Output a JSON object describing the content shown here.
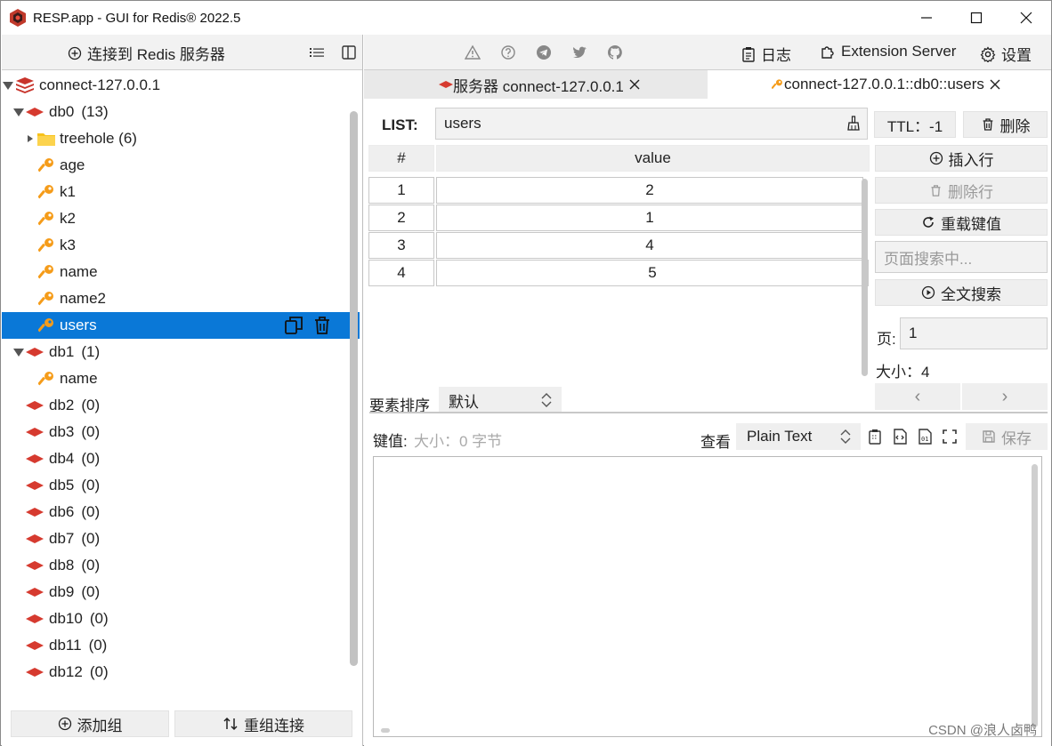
{
  "window": {
    "title": "RESP.app - GUI for Redis® 2022.5"
  },
  "left_toolbar": {
    "connect_label": "连接到 Redis 服务器"
  },
  "tree": {
    "connection": "connect-127.0.0.1",
    "databases": [
      {
        "name": "db0",
        "count": "(13)",
        "expanded": true
      },
      {
        "name": "db1",
        "count": "(1)",
        "expanded": true
      },
      {
        "name": "db2",
        "count": "(0)"
      },
      {
        "name": "db3",
        "count": "(0)"
      },
      {
        "name": "db4",
        "count": "(0)"
      },
      {
        "name": "db5",
        "count": "(0)"
      },
      {
        "name": "db6",
        "count": "(0)"
      },
      {
        "name": "db7",
        "count": "(0)"
      },
      {
        "name": "db8",
        "count": "(0)"
      },
      {
        "name": "db9",
        "count": "(0)"
      },
      {
        "name": "db10",
        "count": "(0)"
      },
      {
        "name": "db11",
        "count": "(0)"
      },
      {
        "name": "db12",
        "count": "(0)"
      }
    ],
    "db0_folder": "treehole (6)",
    "db0_keys": [
      "age",
      "k1",
      "k2",
      "k3",
      "name",
      "name2",
      "users"
    ],
    "db1_keys": [
      "name"
    ],
    "selected_key": "users"
  },
  "left_bottom": {
    "add_group": "添加组",
    "reorder": "重组连接"
  },
  "top_toolbar": {
    "log": "日志",
    "extension": "Extension Server",
    "settings": "设置"
  },
  "tabs": [
    {
      "label": "服务器 connect-127.0.0.1",
      "active": false
    },
    {
      "label": "connect-127.0.0.1::db0::users",
      "active": true
    }
  ],
  "key_view": {
    "type_label": "LIST:",
    "key_name": "users",
    "ttl": "TTL：-1",
    "delete": "删除",
    "columns": [
      "#",
      "value"
    ],
    "rows": [
      {
        "index": "1",
        "value": "2"
      },
      {
        "index": "2",
        "value": "1"
      },
      {
        "index": "3",
        "value": "4"
      },
      {
        "index": "4",
        "value": "5"
      }
    ],
    "insert_row": "插入行",
    "delete_row": "删除行",
    "reload": "重载键值",
    "search_placeholder": "页面搜索中...",
    "fulltext_search": "全文搜索",
    "page_label": "页:",
    "page_value": "1",
    "size_label": "大小：4",
    "prev": "‹",
    "next": "›",
    "sort_label": "要素排序",
    "sort_value": "默认",
    "value_label": "键值:",
    "value_size": "大小：0 字节",
    "view_label": "查看",
    "view_format": "Plain Text",
    "save": "保存"
  },
  "watermark": "CSDN @浪人卤鸭",
  "colors": {
    "accent": "#0a78d7",
    "redis_red": "#d63a2f",
    "key_orange": "#f59c1a",
    "folder_yellow": "#f7c21b"
  }
}
